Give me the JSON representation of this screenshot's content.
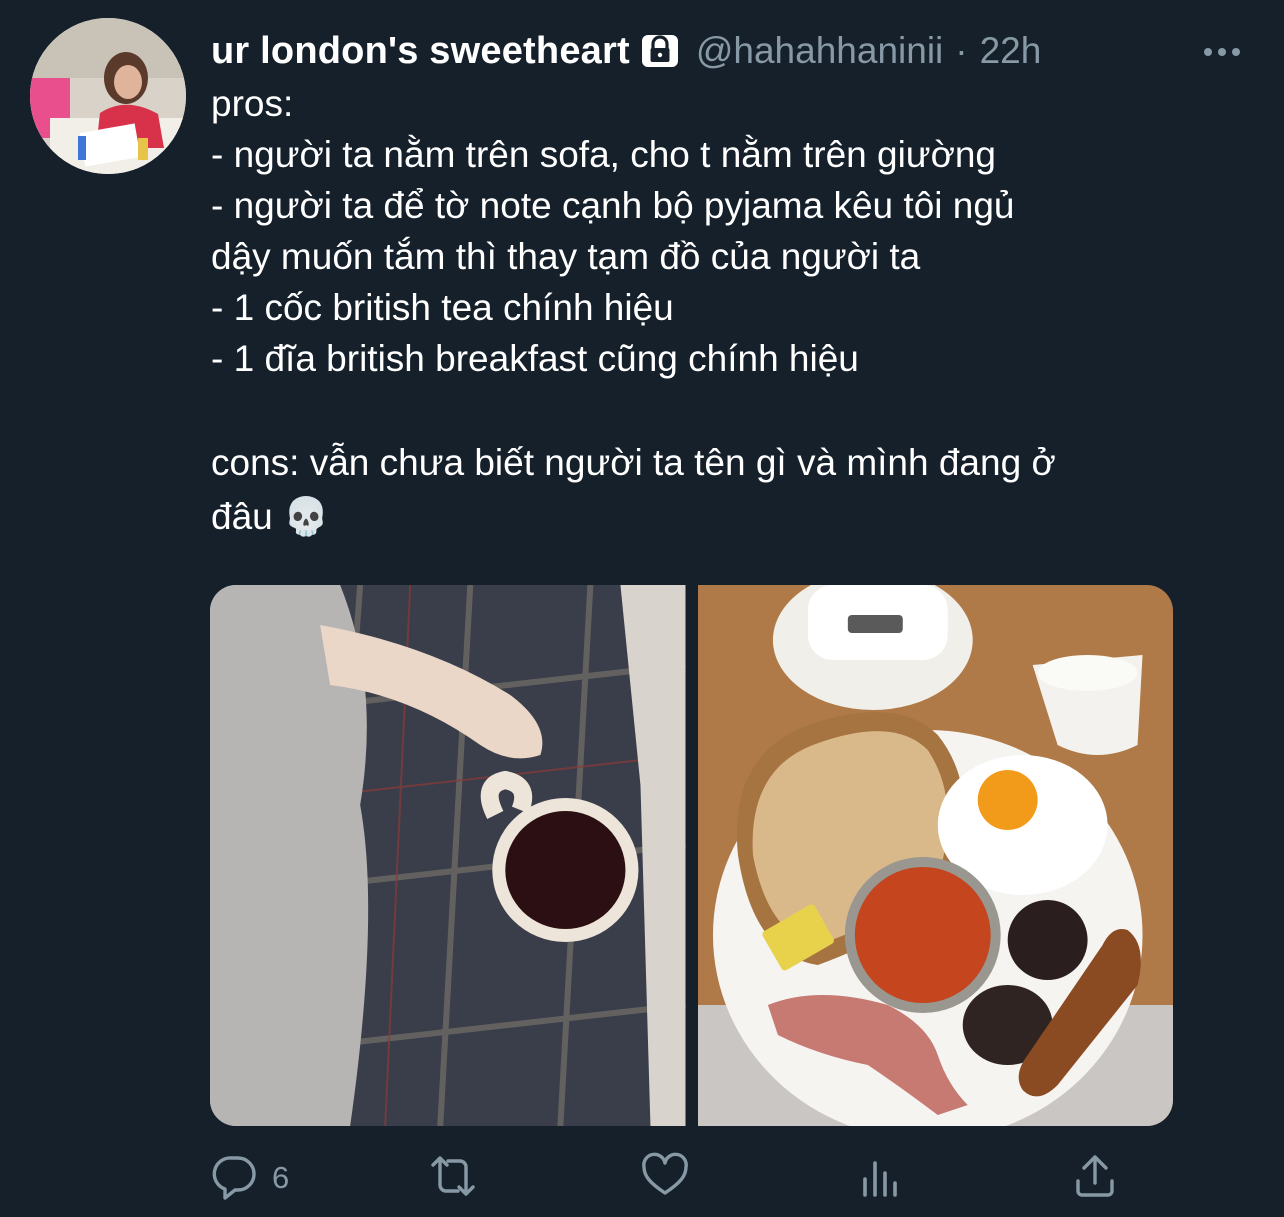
{
  "author": {
    "display_name": "ur london's sweetheart",
    "handle": "@hahahhaninii",
    "separator": "·",
    "time": "22h",
    "protected": true
  },
  "tweet": {
    "lines": [
      "pros:",
      "- người ta nằm trên sofa, cho t nằm trên giường",
      "- người ta để tờ note cạnh bộ pyjama kêu tôi ngủ",
      "dậy muốn tắm thì thay tạm đồ của người ta",
      "- 1 cốc british tea chính hiệu",
      "- 1 đĩa british breakfast cũng chính hiệu"
    ],
    "cons_line1": "cons: vẫn chưa biết người ta tên gì và mình đang ở",
    "cons_line2": "đâu 💀"
  },
  "actions": {
    "reply_count": "6",
    "retweet_count": "",
    "like_count": ""
  },
  "icons": {
    "lock": "lock-icon",
    "more": "more-icon",
    "reply": "reply-icon",
    "retweet": "retweet-icon",
    "like": "heart-icon",
    "analytics": "analytics-icon",
    "share": "share-icon"
  },
  "colors": {
    "background": "#15202b",
    "muted": "#8899a6",
    "text": "#ffffff"
  }
}
